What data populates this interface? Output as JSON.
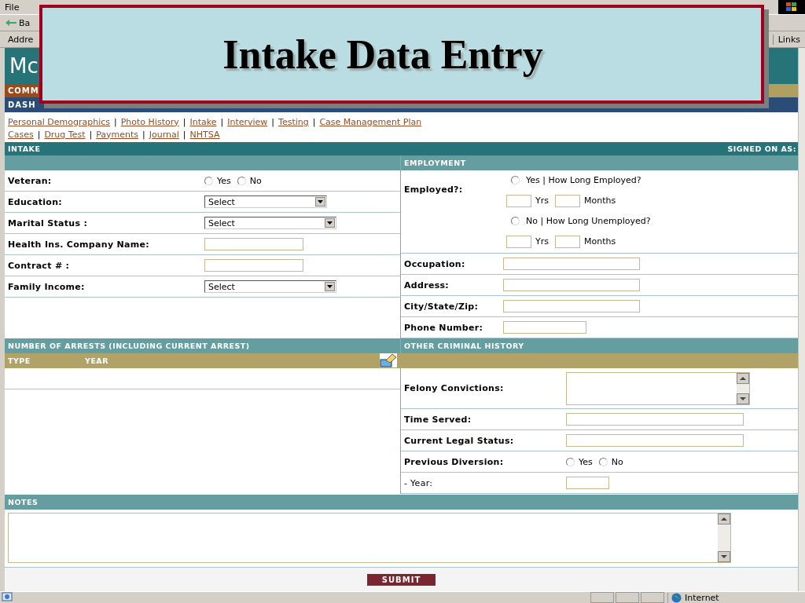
{
  "menu_bar": {
    "items": [
      "File"
    ]
  },
  "toolbar": {
    "back_button": "Ba"
  },
  "address_bar": {
    "label": "Addre",
    "links": "Links"
  },
  "site_header": {
    "logo": "Mc"
  },
  "nav_bars": [
    {
      "kind": "brown",
      "label": "COMM"
    },
    {
      "kind": "blue",
      "label": "DASH"
    }
  ],
  "slide_title": "Intake Data Entry",
  "link_separator": "|",
  "link_rows": [
    [
      "Personal Demographics",
      "Photo History",
      "Intake",
      "Interview",
      "Testing",
      "Case Management Plan"
    ],
    [
      "Cases",
      "Drug Test",
      "Payments",
      "Journal",
      "NHTSA"
    ]
  ],
  "intake": {
    "header": "INTAKE",
    "signed_on": "SIGNED ON AS:",
    "fields": [
      {
        "label": "Veteran:",
        "kind": "radio",
        "options": [
          {
            "label": "Yes",
            "selected": false
          },
          {
            "label": "No",
            "selected": false
          }
        ]
      },
      {
        "label": "Education:",
        "kind": "select",
        "value": "Select"
      },
      {
        "label": "Marital Status :",
        "kind": "select",
        "value": "Select"
      },
      {
        "label": "Health Ins. Company Name:",
        "kind": "text"
      },
      {
        "label": "Contract # :",
        "kind": "text"
      },
      {
        "label": "Family Income:",
        "kind": "select",
        "value": "Select"
      }
    ]
  },
  "employment": {
    "header": "EMPLOYMENT",
    "label": "Employed?:",
    "choices": [
      {
        "label": "Yes | How Long Employed?",
        "selected": false,
        "years": "Yrs",
        "months": "Months"
      },
      {
        "label": "No | How Long Unemployed?",
        "selected": false,
        "years": "Yrs",
        "months": "Months"
      }
    ],
    "fields": [
      {
        "label": "Occupation:",
        "kind": "text"
      },
      {
        "label": "Address:",
        "kind": "text"
      },
      {
        "label": "City/State/Zip:",
        "kind": "text"
      },
      {
        "label": "Phone Number:",
        "kind": "short_text"
      }
    ]
  },
  "arrests": {
    "header": "NUMBER OF ARRESTS (INCLUDING CURRENT ARREST)",
    "columns": [
      "TYPE",
      "YEAR"
    ]
  },
  "criminal_history": {
    "header": "OTHER CRIMINAL HISTORY",
    "fields": [
      {
        "label": "Felony Convictions:",
        "kind": "textarea"
      },
      {
        "label": "Time Served:",
        "kind": "wide_text"
      },
      {
        "label": "Current Legal Status:",
        "kind": "wide_text"
      },
      {
        "label": "Previous Diversion:",
        "kind": "radio",
        "options": [
          {
            "label": "Yes",
            "selected": false
          },
          {
            "label": "No",
            "selected": false
          }
        ]
      },
      {
        "label": "- Year:",
        "kind": "year",
        "plain": true
      }
    ]
  },
  "notes": {
    "header": "NOTES"
  },
  "submit": "SUBMIT",
  "status_bar": {
    "zone": "Internet"
  }
}
